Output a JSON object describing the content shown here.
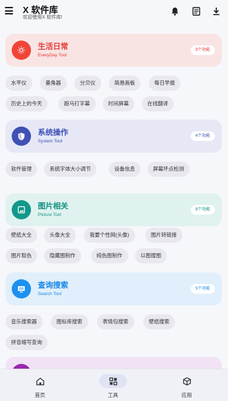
{
  "appbar": {
    "title": "X 软件库",
    "subtitle": "欢迎使用X 软件库!",
    "icons": [
      "menu-icon",
      "bell-icon",
      "document-icon",
      "download-icon"
    ]
  },
  "sections": [
    {
      "title": "生活日常",
      "subtitle": "EveryDay Tool",
      "badge": "9个功能",
      "icon": "sun-icon",
      "accent": "#f04437",
      "card_bg": "#f9e4e4",
      "title_color": "#e53935",
      "chips": [
        "水平仪",
        "量角器",
        "分贝仪",
        "简易画板",
        "每日早报",
        "历史上的今天",
        "跑马打字幕",
        "时间屏幕",
        "在线翻译"
      ]
    },
    {
      "title": "系统操作",
      "subtitle": "System Tool",
      "badge": "4个功能",
      "icon": "shield-icon",
      "accent": "#3f51b5",
      "card_bg": "#e6e8f6",
      "title_color": "#3f51b5",
      "chips": [
        "软件管理",
        "系统字体大小调节",
        "设备信息",
        "屏幕坏点检测"
      ]
    },
    {
      "title": "图片相关",
      "subtitle": "Picture Tool",
      "badge": "8个功能",
      "icon": "image-icon",
      "accent": "#12998a",
      "card_bg": "#e0f2ef",
      "title_color": "#129183",
      "chips": [
        "壁纸大全",
        "头像大全",
        "我要个性网(头像)",
        "图片转链接",
        "图片取色",
        "隐藏图制作",
        "纯色图制作",
        "以图搜图"
      ]
    },
    {
      "title": "查询搜索",
      "subtitle": "Search Tool",
      "badge": "5个功能",
      "icon": "monitor-icon",
      "accent": "#1e90f0",
      "card_bg": "#e0effb",
      "title_color": "#1a88e6",
      "chips": [
        "音乐搜索器",
        "图标库搜索",
        "表情包搜索",
        "壁纸搜索",
        "拼音缩写查询"
      ]
    },
    {
      "title": "",
      "subtitle": "",
      "badge": "",
      "icon": "",
      "accent": "#9c27b0",
      "card_bg": "#f1e3f5",
      "title_color": "#9c27b0",
      "chips": []
    }
  ],
  "bottom_nav": [
    {
      "label": "首页",
      "icon": "home-icon",
      "active": false
    },
    {
      "label": "工具",
      "icon": "apps-icon",
      "active": true
    },
    {
      "label": "应用",
      "icon": "cube-icon",
      "active": false
    }
  ]
}
